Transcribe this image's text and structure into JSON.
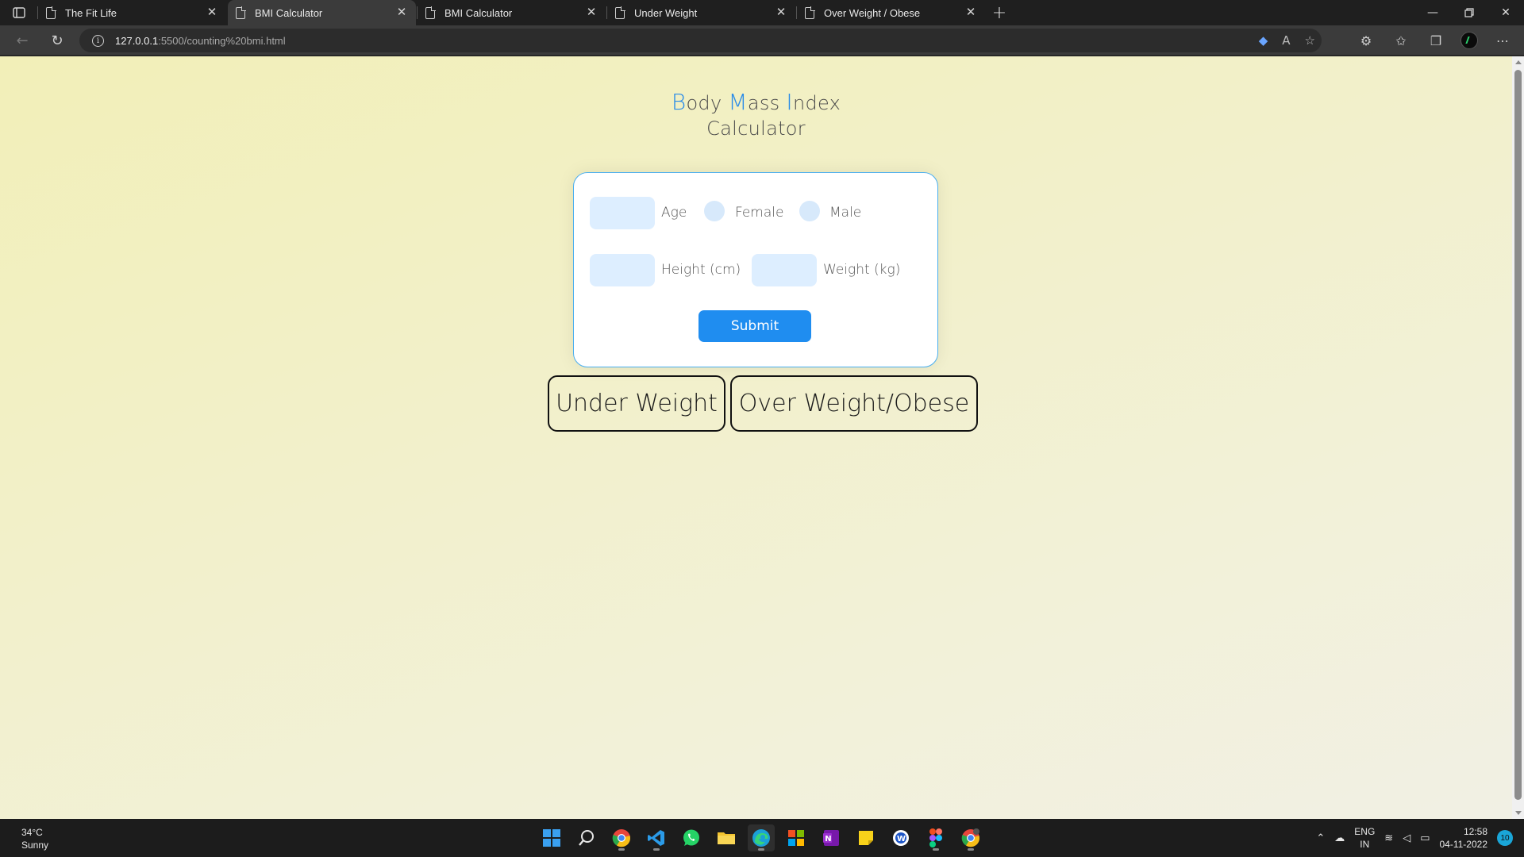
{
  "browser": {
    "tabs": [
      {
        "title": "The Fit Life",
        "active": false
      },
      {
        "title": "BMI Calculator",
        "active": true
      },
      {
        "title": "BMI Calculator",
        "active": false
      },
      {
        "title": "Under Weight",
        "active": false
      },
      {
        "title": "Over Weight / Obese",
        "active": false
      }
    ],
    "url_host": "127.0.0.1",
    "url_path": ":5500/counting%20bmi.html"
  },
  "page": {
    "heading": {
      "line1": [
        {
          "cap": "B",
          "rest": "ody "
        },
        {
          "cap": "M",
          "rest": "ass "
        },
        {
          "cap": "I",
          "rest": "ndex"
        }
      ],
      "line2": "Calculator"
    },
    "form": {
      "age_label": "Age",
      "female_label": "Female",
      "male_label": "Male",
      "height_label": "Height (cm)",
      "weight_label": "Weight (kg)",
      "submit_label": "Submit"
    },
    "links": {
      "under_weight": "Under Weight",
      "over_weight": "Over Weight/Obese"
    }
  },
  "taskbar": {
    "weather_temp": "34°C",
    "weather_desc": "Sunny",
    "lang_line1": "ENG",
    "lang_line2": "IN",
    "time": "12:58",
    "date": "04-11-2022",
    "notification_count": "10"
  },
  "colors": {
    "accent": "#1f8df0",
    "heading_caps": "#2a8ce8",
    "card_border": "#49aef0",
    "input_fill": "#ddeeff"
  }
}
